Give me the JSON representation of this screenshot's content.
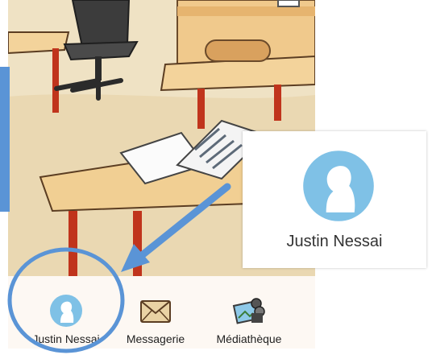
{
  "taskbar": {
    "items": [
      {
        "label": "Justin Nessai",
        "icon": "user-avatar-icon"
      },
      {
        "label": "Messagerie",
        "icon": "envelope-icon"
      },
      {
        "label": "Médiathèque",
        "icon": "media-library-icon"
      }
    ]
  },
  "zoom_callout": {
    "name": "Justin Nessai",
    "icon": "user-avatar-icon"
  },
  "colors": {
    "highlight": "#5a94d6",
    "avatar": "#7fc1e6",
    "desk": "#f1cf93",
    "desk_legs": "#c0341c"
  }
}
